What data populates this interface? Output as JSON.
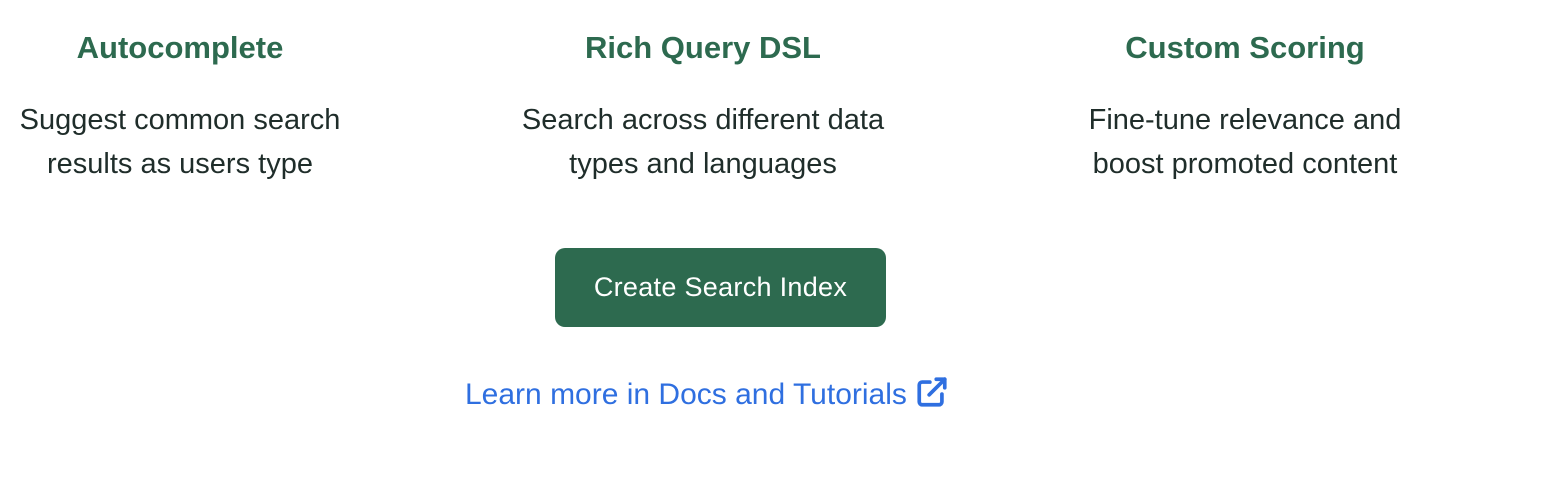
{
  "features": [
    {
      "title": "Autocomplete",
      "description": "Suggest common search\nresults as users type"
    },
    {
      "title": "Rich Query DSL",
      "description": "Search across different data\ntypes and languages"
    },
    {
      "title": "Custom Scoring",
      "description": "Fine-tune relevance and\nboost promoted content"
    }
  ],
  "cta": {
    "label": "Create Search Index"
  },
  "docs_link": {
    "label": "Learn more in Docs and Tutorials",
    "icon": "external-link-icon"
  },
  "colors": {
    "brand_green": "#2d6a4f",
    "link_blue": "#2f6fe0",
    "body_text": "#1f2d2a"
  }
}
